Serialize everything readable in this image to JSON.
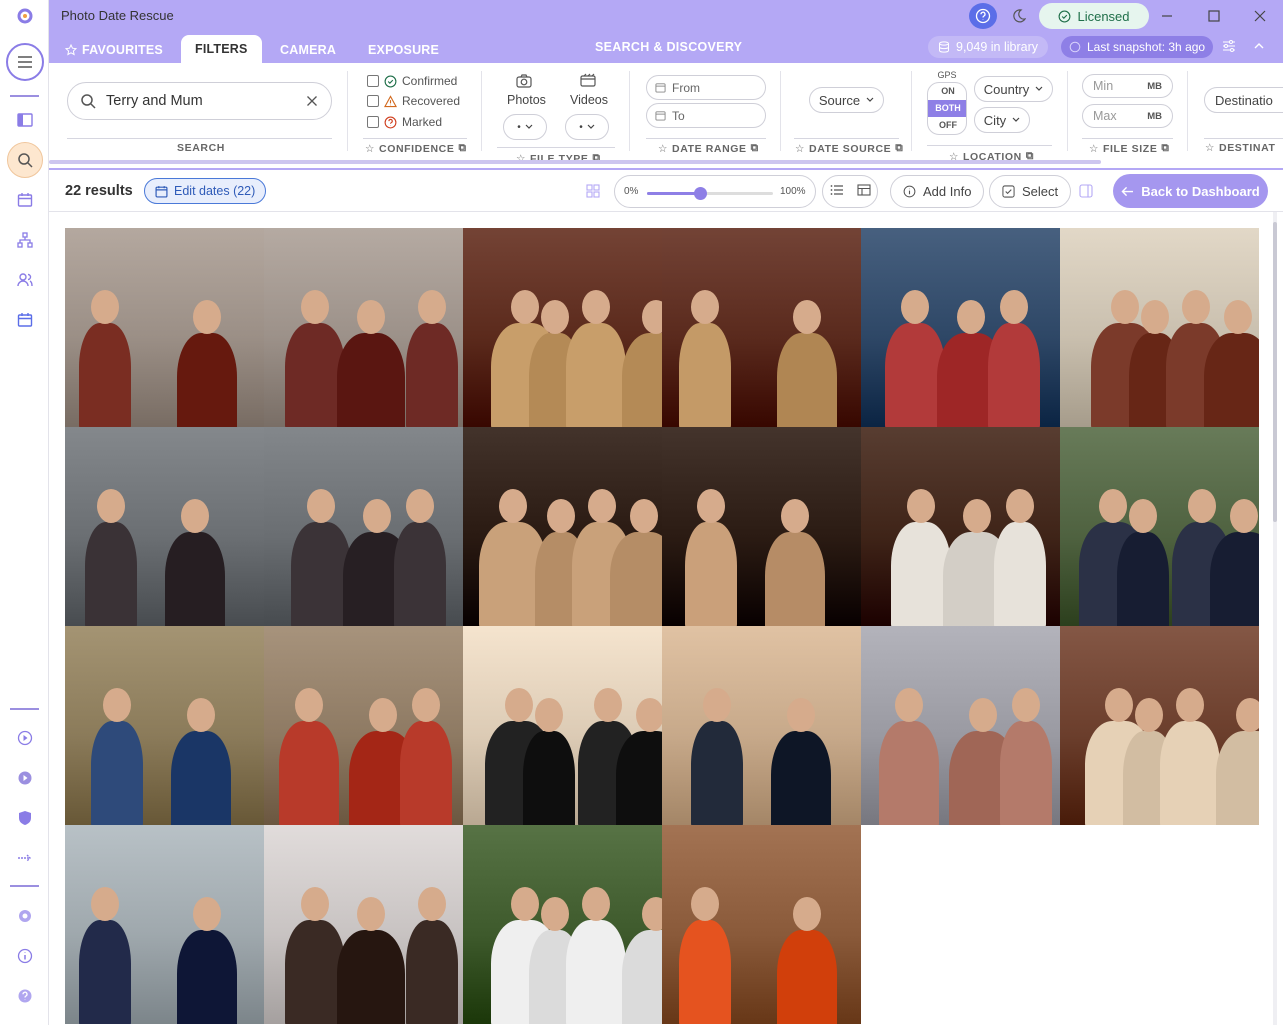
{
  "app": {
    "title": "Photo Date Rescue",
    "licensed_label": "Licensed"
  },
  "tabs": [
    {
      "label": "FAVOURITES"
    },
    {
      "label": "FILTERS"
    },
    {
      "label": "CAMERA"
    },
    {
      "label": "EXPOSURE"
    }
  ],
  "discovery_label": "SEARCH & DISCOVERY",
  "library": {
    "count_label": "9,049 in library",
    "snapshot_label": "Last snapshot: 3h ago"
  },
  "filters": {
    "search": {
      "value": "Terry and Mum",
      "group_label": "SEARCH"
    },
    "confidence": {
      "options": [
        {
          "label": "Confirmed"
        },
        {
          "label": "Recovered"
        },
        {
          "label": "Marked"
        }
      ],
      "group_label": "CONFIDENCE"
    },
    "file_type": {
      "photos_label": "Photos",
      "videos_label": "Videos",
      "group_label": "FILE TYPE"
    },
    "date_range": {
      "from_placeholder": "From",
      "to_placeholder": "To",
      "group_label": "DATE RANGE"
    },
    "date_source": {
      "select_label": "Source",
      "group_label": "DATE SOURCE"
    },
    "location": {
      "gps_label": "GPS",
      "gps_options": [
        "ON",
        "BOTH",
        "OFF"
      ],
      "gps_selected": "BOTH",
      "country_label": "Country",
      "city_label": "City",
      "group_label": "LOCATION"
    },
    "file_size": {
      "min_placeholder": "Min",
      "max_placeholder": "Max",
      "unit": "MB",
      "group_label": "FILE SIZE"
    },
    "destination": {
      "select_label": "Destinatio",
      "group_label": "DESTINAT"
    }
  },
  "toolbar": {
    "results_label": "22 results",
    "edit_dates_label": "Edit dates (22)",
    "zoom_min": "0%",
    "zoom_max": "100%",
    "zoom_value": 0.42,
    "add_info_label": "Add Info",
    "select_label": "Select",
    "back_label": "Back to Dashboard"
  },
  "photos": [
    {
      "bg": "#9b8f86",
      "accent": "#7a2d22",
      "mood": "christmas"
    },
    {
      "bg": "#9c9189",
      "accent": "#6e2a25",
      "mood": "christmas"
    },
    {
      "bg": "#5b2a1c",
      "accent": "#c89e6a",
      "mood": "restaurant"
    },
    {
      "bg": "#5a2a1d",
      "accent": "#c49a67",
      "mood": "restaurant"
    },
    {
      "bg": "#2e4766",
      "accent": "#b23a3a",
      "mood": "party"
    },
    {
      "bg": "#c9bfae",
      "accent": "#7b3a2a",
      "mood": "portrait"
    },
    {
      "bg": "#6b6f73",
      "accent": "#3a3236",
      "mood": "outdoor"
    },
    {
      "bg": "#6a6e72",
      "accent": "#3b3337",
      "mood": "outdoor"
    },
    {
      "bg": "#2a1a12",
      "accent": "#c9a17a",
      "mood": "dinner"
    },
    {
      "bg": "#2b1b13",
      "accent": "#caa07a",
      "mood": "dinner"
    },
    {
      "bg": "#3f2418",
      "accent": "#e7e2da",
      "mood": "dinner"
    },
    {
      "bg": "#4f6240",
      "accent": "#2b3146",
      "mood": "garden"
    },
    {
      "bg": "#8b7b5a",
      "accent": "#2e4a7a",
      "mood": "family"
    },
    {
      "bg": "#8e7a63",
      "accent": "#b83a2a",
      "mood": "family"
    },
    {
      "bg": "#dccbb5",
      "accent": "#222222",
      "mood": "beach"
    },
    {
      "bg": "#c7a98a",
      "accent": "#222a3a",
      "mood": "portrait"
    },
    {
      "bg": "#9a9aa2",
      "accent": "#b47a6a",
      "mood": "portrait"
    },
    {
      "bg": "#6b3e2c",
      "accent": "#e6d1b6",
      "mood": "family"
    },
    {
      "bg": "#9fa8ad",
      "accent": "#222a4a",
      "mood": "wedding"
    },
    {
      "bg": "#c8c3c2",
      "accent": "#3a2a24",
      "mood": "outdoor"
    },
    {
      "bg": "#3e5a2c",
      "accent": "#efefef",
      "mood": "garden"
    },
    {
      "bg": "#8a5a3a",
      "accent": "#e5531f",
      "mood": "table"
    }
  ]
}
